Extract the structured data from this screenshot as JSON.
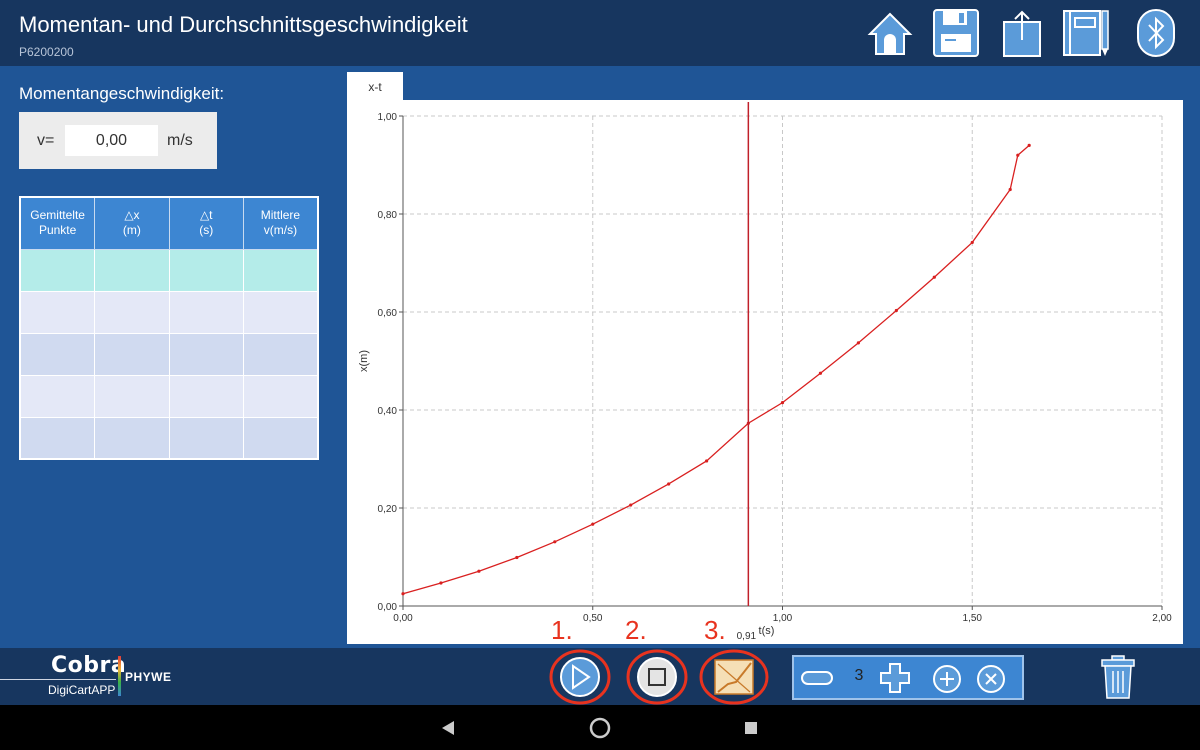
{
  "header": {
    "title": "Momentan- und Durchschnittsgeschwindigkeit",
    "subtitle": "P6200200",
    "icons": [
      "home-icon",
      "save-icon",
      "upload-icon",
      "notebook-icon",
      "bluetooth-icon"
    ]
  },
  "left": {
    "label": "Momentangeschwindigkeit:",
    "v_label": "v=",
    "v_value": "0,00",
    "v_unit": "m/s",
    "table": {
      "headers": [
        [
          "Gemittelte",
          "Punkte"
        ],
        [
          "△x",
          "(m)"
        ],
        [
          "△t",
          "(s)"
        ],
        [
          "Mittlere",
          "v(m/s)"
        ]
      ],
      "rows": [
        [
          "",
          "",
          "",
          ""
        ],
        [
          "",
          "",
          "",
          ""
        ],
        [
          "",
          "",
          "",
          ""
        ],
        [
          "",
          "",
          "",
          ""
        ],
        [
          "",
          "",
          "",
          ""
        ]
      ]
    }
  },
  "tab": {
    "label": "x-t"
  },
  "chart_data": {
    "type": "line",
    "title": "",
    "xlabel": "t(s)",
    "ylabel": "x(m)",
    "xlim": [
      0,
      2
    ],
    "ylim": [
      0,
      1
    ],
    "xticks": [
      "0,00",
      "0,50",
      "1,00",
      "1,50",
      "2,00"
    ],
    "yticks": [
      "0,00",
      "0,20",
      "0,40",
      "0,60",
      "0,80",
      "1,00"
    ],
    "grid": true,
    "cursor": {
      "x": 0.91,
      "label": "0,91"
    },
    "series": [
      {
        "color": "#d92020",
        "x": [
          0.0,
          0.1,
          0.2,
          0.3,
          0.4,
          0.5,
          0.6,
          0.7,
          0.8,
          0.91,
          1.0,
          1.1,
          1.2,
          1.3,
          1.4,
          1.5,
          1.6,
          1.62,
          1.65
        ],
        "y": [
          0.025,
          0.047,
          0.071,
          0.099,
          0.131,
          0.167,
          0.206,
          0.249,
          0.296,
          0.373,
          0.415,
          0.475,
          0.537,
          0.603,
          0.671,
          0.742,
          0.85,
          0.92,
          0.94
        ]
      }
    ]
  },
  "controls": {
    "annotations": [
      "1.",
      "2.",
      "3."
    ],
    "zoom_value": "3"
  },
  "logo": {
    "cobra": "Cobra",
    "phywe": "PHYWE",
    "digi": "DigiCartAPP"
  }
}
